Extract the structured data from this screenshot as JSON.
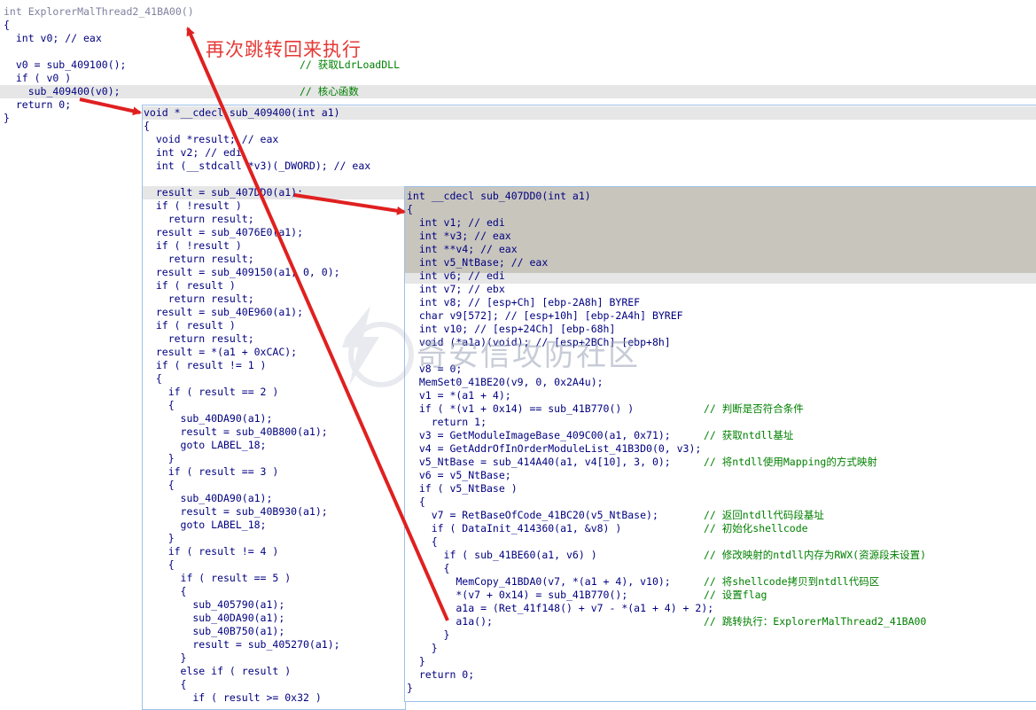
{
  "annotation": "再次跳转回来执行",
  "watermark": "奇安信攻防社区",
  "panel_main": {
    "lines": [
      {
        "code": "int ExplorerMalThread2_41BA00()",
        "comment": "",
        "hl": false,
        "gray": true
      },
      {
        "code": "{",
        "comment": "",
        "hl": false
      },
      {
        "code": "  int v0; // eax",
        "comment": "",
        "hl": false
      },
      {
        "code": "",
        "comment": "",
        "hl": false
      },
      {
        "code": "  v0 = sub_409100();",
        "comment": "// 获取LdrLoadDLL",
        "hl": false
      },
      {
        "code": "  if ( v0 )",
        "comment": "",
        "hl": false
      },
      {
        "code": "    sub_409400(v0);",
        "comment": "// 核心函数",
        "hl": true
      },
      {
        "code": "  return 0;",
        "comment": "",
        "hl": false
      },
      {
        "code": "}",
        "comment": "",
        "hl": false
      }
    ]
  },
  "panel_sub409400_head": {
    "lines": [
      {
        "code": "void *__cdecl sub_409400(int a1)",
        "hl": true
      },
      {
        "code": "{",
        "hl": false
      },
      {
        "code": "  void *result; // eax",
        "hl": false
      },
      {
        "code": "  int v2; // edi",
        "hl": false
      },
      {
        "code": "  int (__stdcall *v3)(_DWORD); // eax",
        "hl": false
      }
    ]
  },
  "panel_sub409400_body": {
    "lines": [
      "  result = sub_407DD0(a1);",
      "  if ( !result )",
      "    return result;",
      "  result = sub_4076E0(a1);",
      "  if ( !result )",
      "    return result;",
      "  result = sub_409150(a1, 0, 0);",
      "  if ( result )",
      "    return result;",
      "  result = sub_40E960(a1);",
      "  if ( result )",
      "    return result;",
      "  result = *(a1 + 0xCAC);",
      "  if ( result != 1 )",
      "  {",
      "    if ( result == 2 )",
      "    {",
      "      sub_40DA90(a1);",
      "      result = sub_40B800(a1);",
      "      goto LABEL_18;",
      "    }",
      "    if ( result == 3 )",
      "    {",
      "      sub_40DA90(a1);",
      "      result = sub_40B930(a1);",
      "      goto LABEL_18;",
      "    }",
      "    if ( result != 4 )",
      "    {",
      "      if ( result == 5 )",
      "      {",
      "        sub_405790(a1);",
      "        sub_40DA90(a1);",
      "        sub_40B750(a1);",
      "        result = sub_405270(a1);",
      "      }",
      "      else if ( result )",
      "      {",
      "        if ( result >= 0x32 )"
    ]
  },
  "panel_sub407dd0": {
    "lines": [
      {
        "code": "int __cdecl sub_407DD0(int a1)",
        "comment": ""
      },
      {
        "code": "{",
        "comment": ""
      },
      {
        "code": "  int v1; // edi",
        "comment": ""
      },
      {
        "code": "  int *v3; // eax",
        "comment": ""
      },
      {
        "code": "  int **v4; // eax",
        "comment": ""
      },
      {
        "code": "  int v5_NtBase; // eax",
        "comment": ""
      },
      {
        "code": "  int v6; // edi",
        "comment": ""
      },
      {
        "code": "  int v7; // ebx",
        "comment": ""
      },
      {
        "code": "  int v8; // [esp+Ch] [ebp-2A8h] BYREF",
        "comment": ""
      },
      {
        "code": "  char v9[572]; // [esp+10h] [ebp-2A4h] BYREF",
        "comment": ""
      },
      {
        "code": "  int v10; // [esp+24Ch] [ebp-68h]",
        "comment": ""
      },
      {
        "code": "  void (*a1a)(void); // [esp+2BCh] [ebp+8h]",
        "comment": ""
      },
      {
        "code": "",
        "comment": ""
      },
      {
        "code": "  v8 = 0;",
        "comment": ""
      },
      {
        "code": "  MemSet0_41BE20(v9, 0, 0x2A4u);",
        "comment": ""
      },
      {
        "code": "  v1 = *(a1 + 4);",
        "comment": ""
      },
      {
        "code": "  if ( *(v1 + 0x14) == sub_41B770() )",
        "comment": "// 判断是否符合条件"
      },
      {
        "code": "    return 1;",
        "comment": ""
      },
      {
        "code": "  v3 = GetModuleImageBase_409C00(a1, 0x71);",
        "comment": "// 获取ntdll基址"
      },
      {
        "code": "  v4 = GetAddrOfInOrderModuleList_41B3D0(0, v3);",
        "comment": ""
      },
      {
        "code": "  v5_NtBase = sub_414A40(a1, v4[10], 3, 0);",
        "comment": "// 将ntdll使用Mapping的方式映射"
      },
      {
        "code": "  v6 = v5_NtBase;",
        "comment": ""
      },
      {
        "code": "  if ( v5_NtBase )",
        "comment": ""
      },
      {
        "code": "  {",
        "comment": ""
      },
      {
        "code": "    v7 = RetBaseOfCode_41BC20(v5_NtBase);",
        "comment": "// 返回ntdll代码段基址"
      },
      {
        "code": "    if ( DataInit_414360(a1, &v8) )",
        "comment": "// 初始化shellcode"
      },
      {
        "code": "    {",
        "comment": ""
      },
      {
        "code": "      if ( sub_41BE60(a1, v6) )",
        "comment": "// 修改映射的ntdll内存为RWX(资源段未设置)"
      },
      {
        "code": "      {",
        "comment": ""
      },
      {
        "code": "        MemCopy_41BDA0(v7, *(a1 + 4), v10);",
        "comment": "// 将shellcode拷贝到ntdll代码区"
      },
      {
        "code": "        *(v7 + 0x14) = sub_41B770();",
        "comment": "// 设置flag"
      },
      {
        "code": "        a1a = (Ret_41f148() + v7 - *(a1 + 4) + 2);",
        "comment": ""
      },
      {
        "code": "        a1a();",
        "comment": "// 跳转执行：ExplorerMalThread2_41BA00"
      },
      {
        "code": "      }",
        "comment": ""
      },
      {
        "code": "    }",
        "comment": ""
      },
      {
        "code": "  }",
        "comment": ""
      },
      {
        "code": "  return 0;",
        "comment": ""
      },
      {
        "code": "}",
        "comment": ""
      }
    ]
  }
}
